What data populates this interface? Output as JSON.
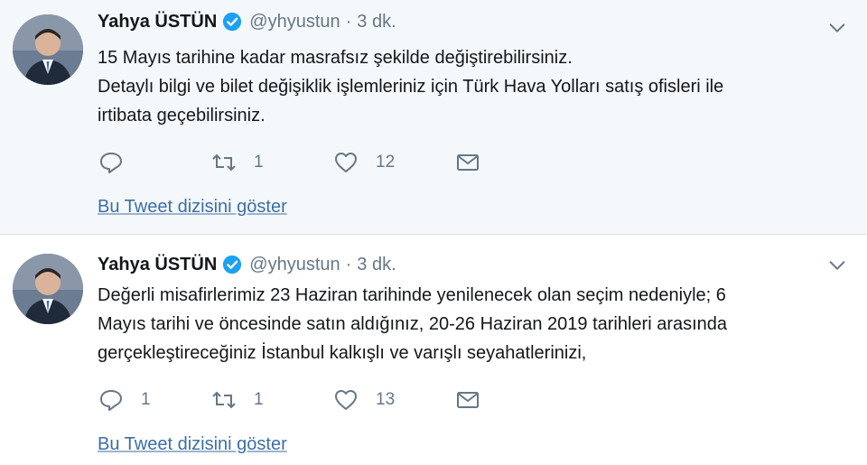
{
  "tweets": [
    {
      "author_name": "Yahya ÜSTÜN",
      "handle": "@yhyustun",
      "separator": "·",
      "time": "3 dk.",
      "text_lines": [
        "15 Mayıs tarihine kadar masrafsız şekilde değiştirebilirsiniz.",
        "Detaylı bilgi ve bilet değişiklik işlemleriniz için Türk Hava Yolları satış ofisleri ile",
        "irtibata geçebilirsiniz."
      ],
      "replies": "",
      "retweets": "1",
      "likes": "12",
      "show_thread": "Bu Tweet dizisini göster"
    },
    {
      "author_name": "Yahya ÜSTÜN",
      "handle": "@yhyustun",
      "separator": "·",
      "time": "3 dk.",
      "text_lines": [
        "Değerli misafirlerimiz 23 Haziran tarihinde yenilenecek olan seçim nedeniyle; 6",
        "Mayıs tarihi ve öncesinde satın aldığınız, 20-26 Haziran 2019 tarihleri arasında",
        "gerçekleştireceğiniz İstanbul kalkışlı ve varışlı seyahatlerinizi,"
      ],
      "replies": "1",
      "retweets": "1",
      "likes": "13",
      "show_thread": "Bu Tweet dizisini göster"
    }
  ],
  "colors": {
    "text": "#14171a",
    "muted": "#657786",
    "verified": "#1da1f2",
    "link": "#3b6fa8",
    "highlight_bg": "#f5f8fa"
  },
  "icons": {
    "verified": "verified-badge-icon",
    "caret": "chevron-down-icon",
    "reply": "reply-icon",
    "retweet": "retweet-icon",
    "like": "heart-icon",
    "dm": "envelope-icon"
  }
}
